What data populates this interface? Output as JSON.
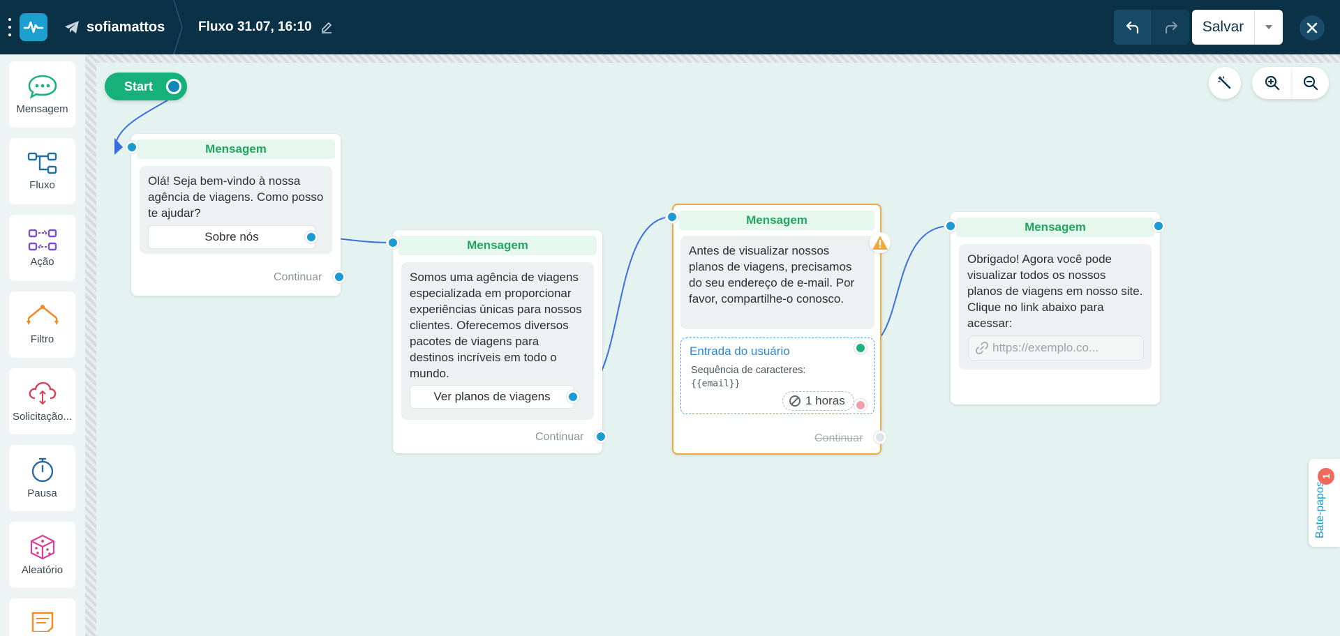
{
  "header": {
    "bot_name": "sofiamattos",
    "flow_title": "Fluxo 31.07, 16:10",
    "save_label": "Salvar"
  },
  "sidebar": {
    "items": [
      {
        "label": "Mensagem",
        "icon": "chat-bubble-icon",
        "color": "#1ab37a"
      },
      {
        "label": "Fluxo",
        "icon": "flow-icon",
        "color": "#1f6f9f"
      },
      {
        "label": "Ação",
        "icon": "action-icon",
        "color": "#7b4fc9"
      },
      {
        "label": "Filtro",
        "icon": "filter-icon",
        "color": "#f08a24"
      },
      {
        "label": "Solicitação...",
        "icon": "cloud-request-icon",
        "color": "#d9405a"
      },
      {
        "label": "Pausa",
        "icon": "stopwatch-icon",
        "color": "#2c6aa0"
      },
      {
        "label": "Aleatório",
        "icon": "dice-icon",
        "color": "#d93f96"
      }
    ]
  },
  "canvas": {
    "start_label": "Start",
    "nodes": [
      {
        "title": "Mensagem",
        "text": "Olá! Seja bem-vindo à nossa agência de viagens. Como posso te ajudar?",
        "button": "Sobre nós",
        "continue": "Continuar"
      },
      {
        "title": "Mensagem",
        "text": "Somos uma agência de viagens especializada em proporcionar experiências únicas para nossos clientes. Oferecemos diversos pacotes de viagens para destinos incríveis em todo o mundo.",
        "button": "Ver planos de viagens",
        "continue": "Continuar"
      },
      {
        "title": "Mensagem",
        "text": "Antes de visualizar nossos planos de viagens, precisamos do seu endereço de e-mail. Por favor, compartilhe-o conosco.",
        "input_title": "Entrada do usuário",
        "input_type": "Sequência de caracteres:",
        "input_var": "{{email}}",
        "timeout": "1 horas",
        "continue": "Continuar"
      },
      {
        "title": "Mensagem",
        "text": "Obrigado! Agora você pode visualizar todos os nossos planos de viagens em nosso site. Clique no link abaixo para acessar:",
        "url_placeholder": "https://exemplo.co..."
      }
    ]
  },
  "chats": {
    "label": "Bate-papos",
    "badge": "1"
  },
  "colors": {
    "header_bg": "#0b3147",
    "accent_green": "#16b07a",
    "port_blue": "#1b9bd1",
    "warning": "#f0a93c"
  }
}
